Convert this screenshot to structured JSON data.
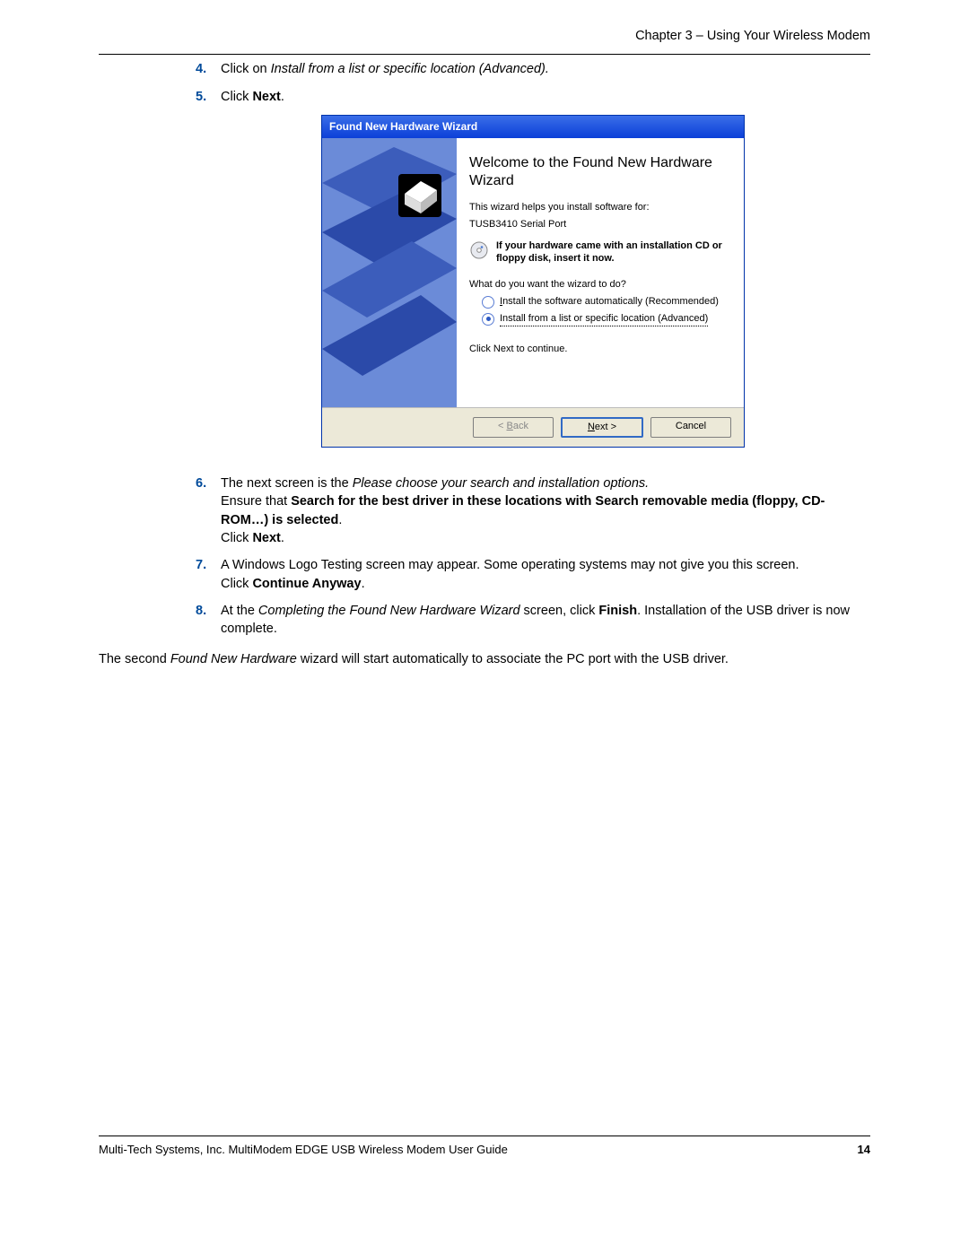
{
  "header": {
    "text": "Chapter 3 – Using Your Wireless Modem"
  },
  "steps": {
    "s4": {
      "num": "4.",
      "pre": "Click on ",
      "italic": "Install from a list or specific location (Advanced)."
    },
    "s5": {
      "num": "5.",
      "pre": "Click ",
      "bold": "Next",
      "post": "."
    },
    "s6": {
      "num": "6.",
      "line1_pre": "The next screen is the ",
      "line1_italic": "Please choose your search and installation options.",
      "line2_pre": "Ensure that ",
      "line2_bold": "Search for the best driver in these locations with Search removable media (floppy, CD-ROM…) is selected",
      "line2_post": ".",
      "line3_pre": "Click ",
      "line3_bold": "Next",
      "line3_post": "."
    },
    "s7": {
      "num": "7.",
      "line1": "A Windows Logo Testing screen may appear.  Some operating systems may not give you this screen.",
      "line2_pre": "Click ",
      "line2_bold": "Continue Anyway",
      "line2_post": "."
    },
    "s8": {
      "num": "8.",
      "pre": "At the ",
      "italic": "Completing the Found New Hardware Wizard",
      "mid": " screen, click ",
      "bold": "Finish",
      "post": ". Installation of the USB driver is now complete."
    }
  },
  "wizard": {
    "title": "Found New Hardware Wizard",
    "heading": "Welcome to the Found New Hardware Wizard",
    "helps": "This wizard helps you install software for:",
    "device": "TUSB3410 Serial Port",
    "cd_hint": "If your hardware came with an installation CD or floppy disk, insert it now.",
    "what": "What do you want the wizard to do?",
    "opt_auto_pre": "I",
    "opt_auto": "nstall the software automatically (Recommended)",
    "opt_list": "Install from a list or specific location (Advanced)",
    "continue": "Click Next to continue.",
    "btn_back": "< Back",
    "btn_next": "Next >",
    "btn_cancel": "Cancel"
  },
  "after": {
    "pre": "The second ",
    "italic": "Found New Hardware",
    "post": " wizard will start automatically to associate the PC port with the USB driver."
  },
  "footer": {
    "left": "Multi-Tech Systems, Inc. MultiModem EDGE USB Wireless Modem User Guide",
    "right": "14"
  }
}
